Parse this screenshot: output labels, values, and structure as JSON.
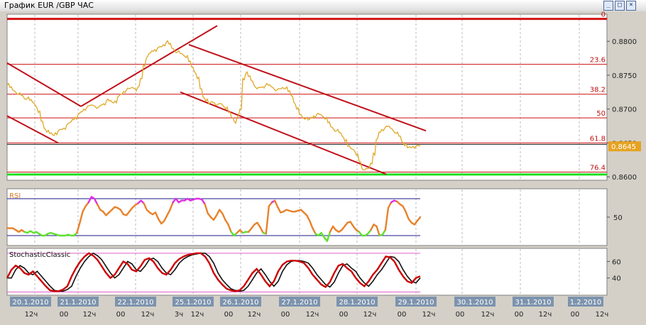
{
  "window": {
    "title": "График EUR /GBP  ЧАС",
    "btn_min": "_",
    "btn_max": "□",
    "btn_close": "×"
  },
  "chart_data": [
    {
      "type": "line",
      "symbol": "EUR/GBP",
      "x": [
        0,
        4,
        8,
        12,
        16,
        20,
        24,
        28,
        32,
        36,
        40,
        44,
        48,
        52,
        56,
        60,
        64,
        68,
        72,
        76,
        80,
        84,
        88,
        92,
        96,
        100,
        104,
        108,
        112,
        116,
        120,
        124,
        128,
        132,
        136,
        140,
        144,
        148,
        152,
        156,
        160,
        164,
        168,
        172,
        176,
        180,
        184,
        188,
        192,
        196,
        200,
        204,
        208,
        212,
        216,
        220,
        224,
        228,
        232,
        236,
        240,
        244,
        248,
        252,
        256,
        260,
        264,
        268,
        272,
        276,
        280,
        284,
        288,
        292,
        296,
        300,
        304,
        308,
        312,
        316,
        320,
        324,
        328,
        332,
        336,
        340,
        344,
        348,
        352,
        356,
        360,
        364,
        368,
        372,
        376,
        380,
        384,
        388,
        392,
        396,
        400,
        404,
        408,
        412,
        416,
        420,
        424,
        428,
        432,
        436,
        440,
        444,
        448,
        452,
        456,
        460,
        464,
        468,
        472,
        476,
        480,
        484,
        488,
        492,
        496,
        500,
        504,
        508,
        512,
        516,
        520,
        524,
        528,
        532,
        536,
        540,
        544,
        548,
        552,
        556,
        560,
        564,
        568,
        572,
        576,
        580
      ],
      "values": [
        0.8735,
        0.8732,
        0.8728,
        0.8725,
        0.8722,
        0.872,
        0.8716,
        0.8715,
        0.8713,
        0.871,
        0.8705,
        0.8695,
        0.8682,
        0.8672,
        0.8666,
        0.8664,
        0.8662,
        0.8665,
        0.8668,
        0.867,
        0.8672,
        0.8676,
        0.868,
        0.8685,
        0.8688,
        0.8692,
        0.8696,
        0.87,
        0.8702,
        0.8705,
        0.8706,
        0.8704,
        0.8702,
        0.8706,
        0.8708,
        0.8712,
        0.8712,
        0.871,
        0.8712,
        0.8718,
        0.8722,
        0.8726,
        0.8728,
        0.873,
        0.8732,
        0.873,
        0.8732,
        0.8745,
        0.8765,
        0.8775,
        0.8782,
        0.8786,
        0.8788,
        0.879,
        0.8792,
        0.8795,
        0.8798,
        0.8796,
        0.879,
        0.8786,
        0.8784,
        0.8782,
        0.878,
        0.8776,
        0.877,
        0.8762,
        0.8755,
        0.8745,
        0.873,
        0.8718,
        0.8712,
        0.8708,
        0.8711,
        0.8709,
        0.8706,
        0.8708,
        0.8705,
        0.87,
        0.8695,
        0.8688,
        0.8682,
        0.8688,
        0.87,
        0.8745,
        0.8752,
        0.8748,
        0.8742,
        0.8735,
        0.873,
        0.8732,
        0.8733,
        0.8735,
        0.8735,
        0.8733,
        0.873,
        0.8728,
        0.873,
        0.8732,
        0.873,
        0.8726,
        0.872,
        0.871,
        0.87,
        0.8692,
        0.8688,
        0.8685,
        0.8684,
        0.8688,
        0.869,
        0.8692,
        0.8692,
        0.869,
        0.8685,
        0.868,
        0.8674,
        0.867,
        0.8668,
        0.8665,
        0.866,
        0.8652,
        0.8645,
        0.8642,
        0.864,
        0.8632,
        0.8622,
        0.8612,
        0.861,
        0.8612,
        0.862,
        0.8635,
        0.8655,
        0.8666,
        0.867,
        0.8672,
        0.8674,
        0.8672,
        0.8668,
        0.8664,
        0.866,
        0.8652,
        0.8646,
        0.8643,
        0.8644,
        0.8645,
        0.8645,
        0.8646
      ],
      "ylim": [
        0.8595,
        0.884
      ],
      "yticks": [
        "0.8800",
        "0.8750",
        "0.8700",
        "0.8650",
        "0.8600"
      ],
      "ytick_values": [
        0.88,
        0.875,
        0.87,
        0.865,
        0.86
      ],
      "last_price": "0.8645",
      "fib_levels": [
        {
          "label": "0",
          "value": 0.8833
        },
        {
          "label": "23.6",
          "value": 0.8766
        },
        {
          "label": "38.2",
          "value": 0.8722
        },
        {
          "label": "50",
          "value": 0.8687
        },
        {
          "label": "61.8",
          "value": 0.865
        },
        {
          "label": "76.4",
          "value": 0.8607
        }
      ],
      "trendlines": [
        {
          "x1": 0,
          "y1": 0.8768,
          "x2": 104,
          "y2": 0.8704
        },
        {
          "x1": 104,
          "y1": 0.8704,
          "x2": 296,
          "y2": 0.8823
        },
        {
          "x1": 0,
          "y1": 0.869,
          "x2": 72,
          "y2": 0.865
        },
        {
          "x1": 256,
          "y1": 0.8795,
          "x2": 590,
          "y2": 0.8668
        },
        {
          "x1": 244,
          "y1": 0.8725,
          "x2": 534,
          "y2": 0.8604
        }
      ]
    },
    {
      "type": "line",
      "name": "RSI",
      "ytick_labels": [
        "50"
      ],
      "ytick_values": [
        50
      ],
      "ylim": [
        20,
        80
      ],
      "band_upper": 70,
      "band_lower": 30,
      "values": [
        38,
        38,
        38,
        36,
        34,
        36,
        34,
        33,
        35,
        33,
        34,
        32,
        30,
        30,
        32,
        33,
        32,
        31,
        30,
        30,
        30,
        31,
        30,
        30,
        33,
        44,
        56,
        62,
        66,
        72,
        70,
        64,
        58,
        56,
        52,
        55,
        58,
        61,
        60,
        58,
        53,
        52,
        56,
        60,
        63,
        65,
        68,
        65,
        58,
        55,
        53,
        55,
        48,
        43,
        46,
        52,
        58,
        66,
        70,
        66,
        68,
        68,
        70,
        68,
        69,
        70,
        70,
        69,
        64,
        54,
        50,
        47,
        52,
        58,
        54,
        47,
        42,
        34,
        30,
        33,
        36,
        33,
        34,
        34,
        38,
        42,
        44,
        39,
        33,
        32,
        62,
        66,
        68,
        61,
        55,
        56,
        58,
        57,
        56,
        56,
        57,
        58,
        55,
        52,
        46,
        38,
        32,
        30,
        33,
        28,
        24,
        34,
        40,
        36,
        34,
        36,
        40,
        44,
        45,
        40,
        36,
        34,
        30,
        30,
        32,
        36,
        42,
        40,
        30,
        31,
        36,
        60,
        66,
        68,
        67,
        64,
        62,
        56,
        48,
        44,
        42,
        46,
        50
      ],
      "colors": {
        "normal": "#e8822a",
        "oversold": "#5fe02f",
        "overbought": "#e030e0"
      }
    },
    {
      "type": "line",
      "name": "StochasticClassic",
      "ytick_labels": [
        "60",
        "40"
      ],
      "ytick_values": [
        60,
        40
      ],
      "ylim": [
        20,
        75
      ],
      "band_upper": 70,
      "band_lower": 23,
      "values": [
        40,
        50,
        55,
        52,
        46,
        44,
        48,
        42,
        36,
        30,
        25,
        24,
        24,
        26,
        30,
        42,
        52,
        60,
        66,
        70,
        67,
        62,
        54,
        46,
        40,
        44,
        52,
        60,
        57,
        50,
        48,
        54,
        62,
        64,
        60,
        52,
        46,
        44,
        50,
        58,
        63,
        66,
        68,
        69,
        70,
        70,
        66,
        58,
        46,
        38,
        32,
        27,
        25,
        24,
        25,
        30,
        38,
        46,
        51,
        44,
        36,
        30,
        36,
        48,
        56,
        60,
        61,
        61,
        60,
        58,
        52,
        44,
        38,
        32,
        29,
        35,
        46,
        55,
        57,
        52,
        48,
        40,
        34,
        30,
        36,
        44,
        50,
        58,
        66,
        65,
        60,
        50,
        42,
        36,
        34,
        40,
        42
      ],
      "signal_lag": 1
    }
  ],
  "x_axis": {
    "dates": [
      "20.1.2010",
      "21.1.2010",
      "22.1.2010",
      "25.1.2010",
      "26.1.2010",
      "27.1.2010",
      "28.1.2010",
      "29.1.2010",
      "30.1.2010",
      "31.1.2010",
      "1.2.2010"
    ],
    "date_x": [
      43,
      110,
      191,
      272,
      339,
      422,
      503,
      586,
      669,
      751,
      825
    ],
    "sub_labels": [
      {
        "text": "12ч",
        "x": 44
      },
      {
        "text": "00",
        "x": 90
      },
      {
        "text": "12ч",
        "x": 126
      },
      {
        "text": "00",
        "x": 170
      },
      {
        "text": "12ч",
        "x": 208
      },
      {
        "text": "3ч",
        "x": 252
      },
      {
        "text": "12ч",
        "x": 278
      },
      {
        "text": "00",
        "x": 322
      },
      {
        "text": "12ч",
        "x": 358
      },
      {
        "text": "00",
        "x": 402
      },
      {
        "text": "12ч",
        "x": 440
      },
      {
        "text": "00",
        "x": 484
      },
      {
        "text": "12ч",
        "x": 521
      },
      {
        "text": "00",
        "x": 566
      },
      {
        "text": "12ч",
        "x": 604
      },
      {
        "text": "00",
        "x": 648
      },
      {
        "text": "12ч",
        "x": 687
      },
      {
        "text": "00",
        "x": 731
      },
      {
        "text": "12ч",
        "x": 768
      },
      {
        "text": "00",
        "x": 810
      },
      {
        "text": "12ч",
        "x": 848
      }
    ]
  },
  "colors": {
    "price_line": "#dfa826",
    "fib_line": "#cc1111",
    "zero_line": "#d11414",
    "green_line": "#19e11e",
    "trendline": "#c0101a",
    "stoch_main": "#cc0000",
    "stoch_signal": "#111111",
    "band": "#1a1a8a",
    "stoch_band": "#e060c8",
    "date_tag": "#7d93ad",
    "grid": "#bbbbbb",
    "last_price_bg": "#e6a322"
  }
}
